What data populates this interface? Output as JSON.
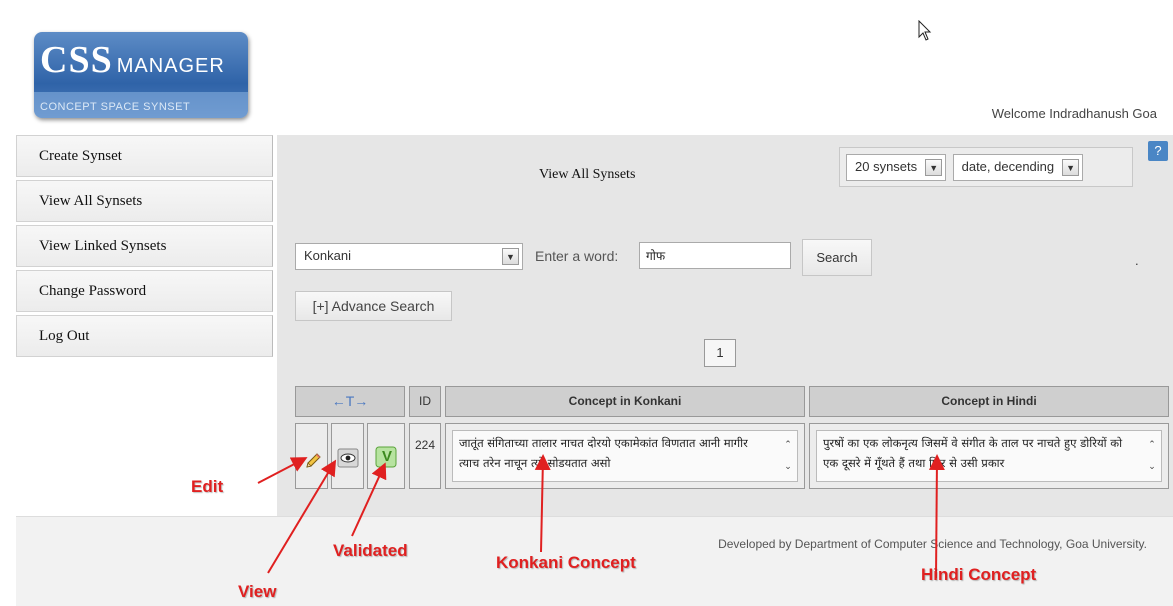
{
  "header": {
    "logo_main": "CSS",
    "logo_manager": "MANAGER",
    "logo_subtitle": "CONCEPT SPACE SYNSET",
    "welcome": "Welcome Indradhanush Goa"
  },
  "sidebar": {
    "items": [
      {
        "label": "Create Synset"
      },
      {
        "label": "View All Synsets"
      },
      {
        "label": "View Linked Synsets"
      },
      {
        "label": "Change Password"
      },
      {
        "label": "Log Out"
      }
    ]
  },
  "main": {
    "help_label": "?",
    "title": "View All Synsets",
    "per_page": "20 synsets",
    "sort_order": "date, decending",
    "language": "Konkani",
    "enter_word_label": "Enter a word:",
    "word_value": "गोफ",
    "search_label": "Search",
    "dot": ".",
    "advance_search_label": "[+] Advance Search",
    "page_number": "1"
  },
  "table": {
    "actions_header": "←T→",
    "id_header": "ID",
    "konkani_header": "Concept in Konkani",
    "hindi_header": "Concept in Hindi",
    "rows": [
      {
        "id": "224",
        "konkani": "जातूंत संगिताच्या तालार नाचत दोरयो एकामेकांत विणतात आनी मागीर त्याच तरेन नाचून त्यो सोडयतात असो",
        "hindi": "पुरषों का एक लोकनृत्य जिसमें वे संगीत के ताल पर नाचते हुए डोरियों को एक दूसरे में गूँथते हैं तथा फिर से उसी प्रकार"
      }
    ]
  },
  "icons": {
    "edit": "pencil-icon",
    "view": "eye-icon",
    "validated": "check-v-icon",
    "validated_letter": "V"
  },
  "footer": {
    "text": "Developed by Department of Computer Science and Technology, Goa University."
  },
  "callouts": {
    "edit": "Edit",
    "view": "View",
    "validated": "Validated",
    "konkani_concept": "Konkani Concept",
    "hindi_concept": "Hindi Concept"
  },
  "colors": {
    "callout": "#e02020",
    "help_button": "#4a86c5",
    "logo_blue": "#2f63a8"
  }
}
